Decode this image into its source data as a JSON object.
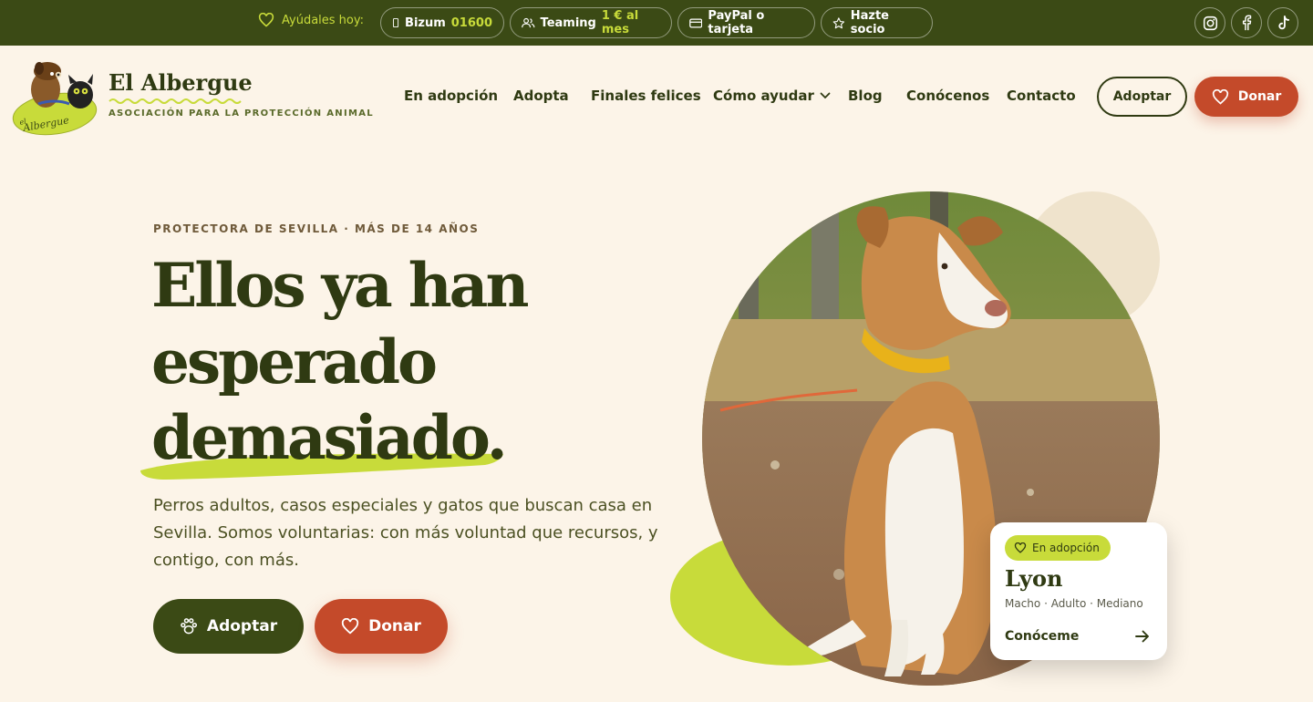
{
  "topbar": {
    "help_label": "Ayúdales hoy:",
    "bizum": {
      "label": "Bizum",
      "value": "01600"
    },
    "teaming": {
      "label": "Teaming",
      "value": "1 € al mes"
    },
    "paypal": {
      "label": "PayPal o tarjeta"
    },
    "socio": {
      "label": "Hazte socio"
    },
    "social": [
      "instagram-icon",
      "facebook-icon",
      "tiktok-icon"
    ]
  },
  "brand": {
    "name": "El Albergue",
    "tagline": "ASOCIACIÓN PARA LA PROTECCIÓN ANIMAL"
  },
  "nav": {
    "items": [
      "En adopción",
      "Adopta",
      "Finales felices",
      "Cómo ayudar",
      "Blog",
      "Conócenos",
      "Contacto"
    ],
    "adopt_button": "Adoptar",
    "donate_button": "Donar"
  },
  "hero": {
    "eyebrow": "PROTECTORA DE SEVILLA · MÁS DE 14 AÑOS",
    "title_line1": "Ellos ya han",
    "title_line2": "esperado",
    "title_line3": "demasiado.",
    "lead": "Perros adultos, casos especiales y gatos que buscan casa en Sevilla. Somos voluntarias: con más voluntad que recursos, y contigo, con más.",
    "cta_adopt": "Adoptar",
    "cta_donate": "Donar"
  },
  "featured_pet": {
    "badge": "En adopción",
    "name": "Lyon",
    "meta": "Macho · Adulto · Mediano",
    "link": "Conóceme"
  },
  "colors": {
    "topbar_bg": "#3b4a15",
    "accent_lime": "#c8db3a",
    "donate_red": "#c44a2a",
    "page_bg": "#fcf4e8",
    "text_dark": "#2f3a12"
  }
}
